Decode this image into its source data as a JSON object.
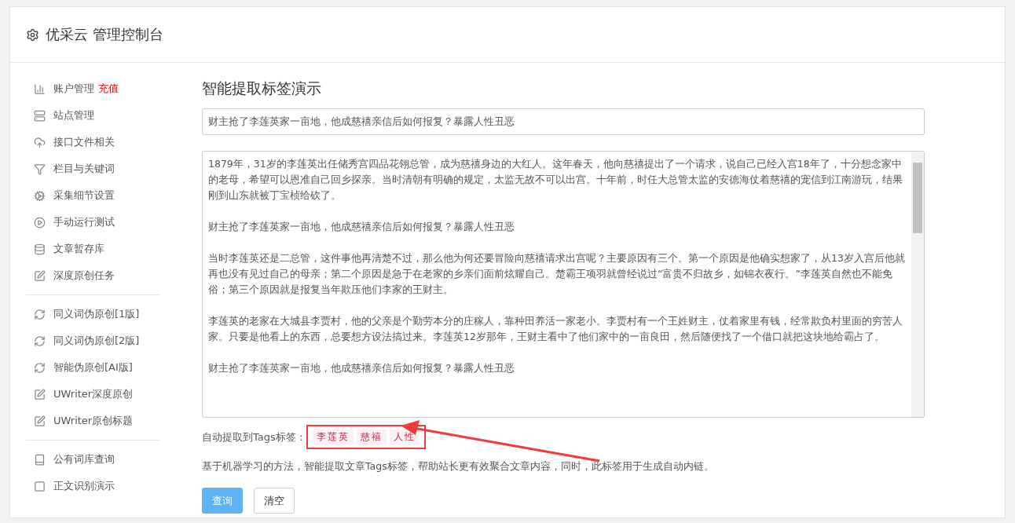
{
  "header": {
    "title": "优采云 管理控制台"
  },
  "sidebar": {
    "groups": [
      [
        {
          "label": "账户管理",
          "badge": "充值"
        },
        {
          "label": "站点管理"
        },
        {
          "label": "接口文件相关"
        },
        {
          "label": "栏目与关键词"
        },
        {
          "label": "采集细节设置"
        },
        {
          "label": "手动运行测试"
        },
        {
          "label": "文章暂存库"
        },
        {
          "label": "深度原创任务"
        }
      ],
      [
        {
          "label": "同义词伪原创[1版]"
        },
        {
          "label": "同义词伪原创[2版]"
        },
        {
          "label": "智能伪原创[AI版]"
        },
        {
          "label": "UWriter深度原创"
        },
        {
          "label": "UWriter原创标题"
        }
      ],
      [
        {
          "label": "公有词库查询"
        },
        {
          "label": "正文识别演示"
        }
      ]
    ]
  },
  "main": {
    "title": "智能提取标签演示",
    "headline_field": {
      "value": "财主抢了李莲英家一亩地，他成慈禧亲信后如何报复？暴露人性丑恶"
    },
    "article": {
      "paragraphs": [
        "1879年，31岁的李莲英出任储秀宫四品花翎总管，成为慈禧身边的大红人。这年春天，他向慈禧提出了一个请求，说自己已经入宫18年了，十分想念家中的老母，希望可以恩准自己回乡探亲。当时清朝有明确的规定，太监无故不可以出宫。十年前，时任大总管太监的安德海仗着慈禧的宠信到江南游玩，结果刚到山东就被丁宝桢给砍了。",
        "财主抢了李莲英家一亩地，他成慈禧亲信后如何报复？暴露人性丑恶",
        "当时李莲英还是二总管，这件事他再清楚不过，那么他为何还要冒险向慈禧请求出宫呢？主要原因有三个。第一个原因是他确实想家了，从13岁入宫后他就再也没有见过自己的母亲；第二个原因是急于在老家的乡亲们面前炫耀自己。楚霸王项羽就曾经说过“富贵不归故乡，如锦衣夜行。”李莲英自然也不能免俗；第三个原因就是报复当年欺压他们李家的王财主。",
        "李莲英的老家在大城县李贾村，他的父亲是个勤劳本分的庄稼人，靠种田养活一家老小。李贾村有一个王姓财主，仗着家里有钱，经常欺负村里面的穷苦人家。只要是他看上的东西，总要想方设法搞过来。李莲英12岁那年，王财主看中了他们家中的一亩良田，然后随便找了一个借口就把这块地给霸占了。",
        "财主抢了李莲英家一亩地，他成慈禧亲信后如何报复？暴露人性丑恶"
      ]
    },
    "tags": {
      "label": "自动提取到Tags标签：",
      "items": [
        "李莲英",
        "慈禧",
        "人性"
      ],
      "highlighted": true
    },
    "note": "基于机器学习的方法，智能提取文章Tags标签，帮助站长更有效聚合文章内容，同时，此标签用于生成自动内链。",
    "buttons": [
      {
        "label": "查询",
        "kind": "primary"
      },
      {
        "label": "清空",
        "kind": "default"
      }
    ]
  }
}
